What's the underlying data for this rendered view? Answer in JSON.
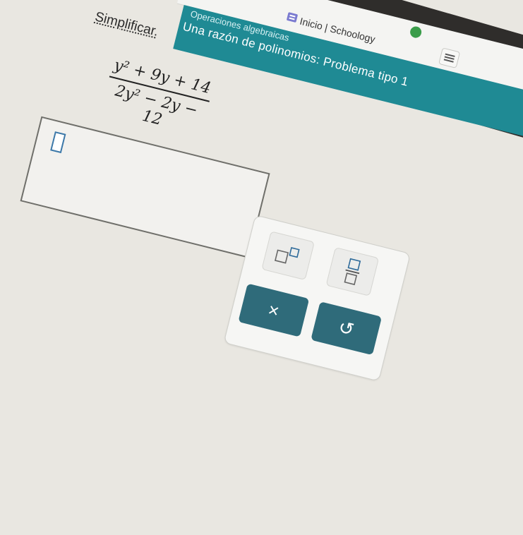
{
  "browser": {
    "tab_title": "Inicio | Schoology",
    "icons": [
      "schoology-favicon",
      "extension-icon",
      "menu-icon"
    ]
  },
  "header": {
    "section": "Operaciones algebraicas",
    "title": "Una razón de polinomios: Problema tipo 1"
  },
  "problem": {
    "instruction": "Simplificar.",
    "numerator": "y² + 9y + 14",
    "denominator": "2y² − 2y − 12"
  },
  "answer": {
    "value": ""
  },
  "toolbar": {
    "superscript_icon": "superscript-template-icon",
    "fraction_icon": "fraction-template-icon",
    "clear_label": "×",
    "undo_label": "↺"
  },
  "colors": {
    "banner": "#1f8a94",
    "action_button": "#2f6b7a",
    "slot_border": "#3c78a8"
  }
}
